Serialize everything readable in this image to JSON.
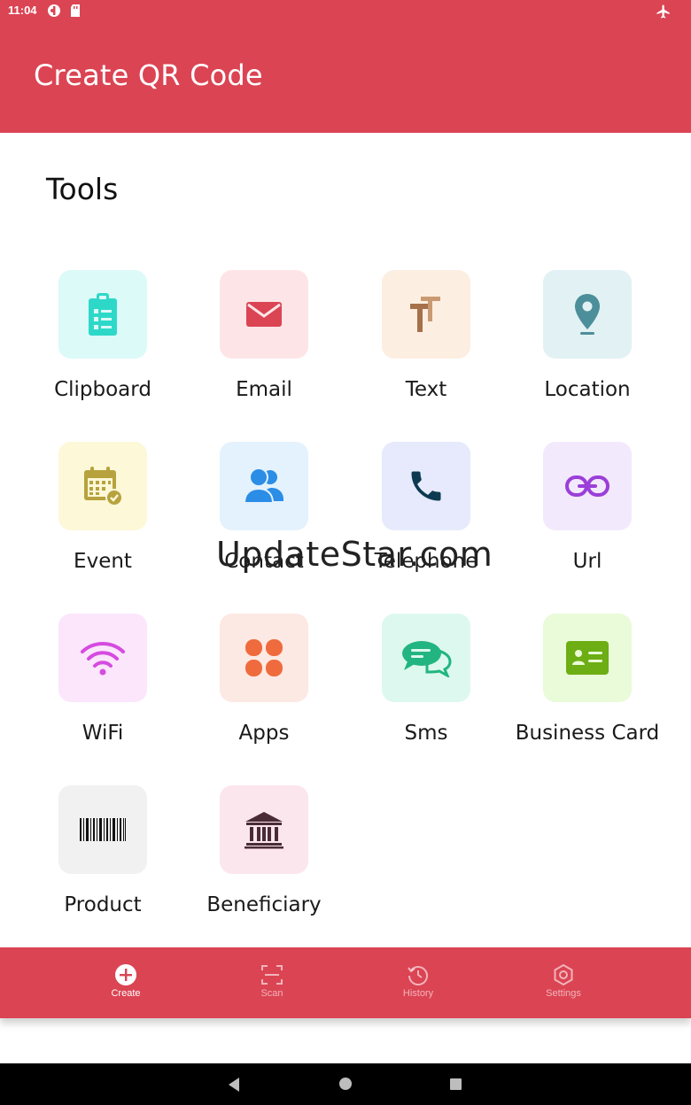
{
  "status_bar": {
    "time": "11:04",
    "left_icons": [
      "vpn-key-icon",
      "sd-card-icon"
    ],
    "right_icons": [
      "airplane-mode-icon"
    ]
  },
  "app_bar": {
    "title": "Create QR Code",
    "color": "#db4453"
  },
  "tools": {
    "heading": "Tools",
    "items": [
      {
        "label": "Clipboard",
        "icon": "clipboard-icon",
        "tile_bg": "#dbfaf8",
        "icon_color": "#2ed8c9"
      },
      {
        "label": "Email",
        "icon": "email-icon",
        "tile_bg": "#fde4e7",
        "icon_color": "#db4453"
      },
      {
        "label": "Text",
        "icon": "text-icon",
        "tile_bg": "#fdeee2",
        "icon_color": "#a6714a"
      },
      {
        "label": "Location",
        "icon": "location-pin-icon",
        "tile_bg": "#e2f1f3",
        "icon_color": "#4c8f9a"
      },
      {
        "label": "Event",
        "icon": "calendar-icon",
        "tile_bg": "#fcf8d8",
        "icon_color": "#b7a23e"
      },
      {
        "label": "Contact",
        "icon": "contacts-icon",
        "tile_bg": "#e3f2fd",
        "icon_color": "#2b8de6"
      },
      {
        "label": "Telephone",
        "icon": "phone-icon",
        "tile_bg": "#e6eafc",
        "icon_color": "#0d3a4f"
      },
      {
        "label": "Url",
        "icon": "link-icon",
        "tile_bg": "#f3e9fc",
        "icon_color": "#9b3fd8"
      },
      {
        "label": "WiFi",
        "icon": "wifi-icon",
        "tile_bg": "#fbe6fc",
        "icon_color": "#d54be0"
      },
      {
        "label": "Apps",
        "icon": "apps-icon",
        "tile_bg": "#fde9e3",
        "icon_color": "#ef6b3d"
      },
      {
        "label": "Sms",
        "icon": "sms-icon",
        "tile_bg": "#ddf9ef",
        "icon_color": "#23b581"
      },
      {
        "label": "Business Card",
        "icon": "business-card-icon",
        "tile_bg": "#e9fbd8",
        "icon_color": "#6cae13"
      },
      {
        "label": "Product",
        "icon": "barcode-icon",
        "tile_bg": "#f1f1f1",
        "icon_color": "#111111"
      },
      {
        "label": "Beneficiary",
        "icon": "bank-icon",
        "tile_bg": "#fce6ee",
        "icon_color": "#4a2c36"
      }
    ]
  },
  "watermark": "UpdateStar.com",
  "bottom_nav": {
    "items": [
      {
        "label": "Create",
        "icon": "add-circle-icon",
        "active": true
      },
      {
        "label": "Scan",
        "icon": "scan-icon",
        "active": false
      },
      {
        "label": "History",
        "icon": "history-icon",
        "active": false
      },
      {
        "label": "Settings",
        "icon": "settings-icon",
        "active": false
      }
    ]
  },
  "system_nav": {
    "icons": [
      "back-icon",
      "home-icon",
      "recents-icon"
    ]
  }
}
